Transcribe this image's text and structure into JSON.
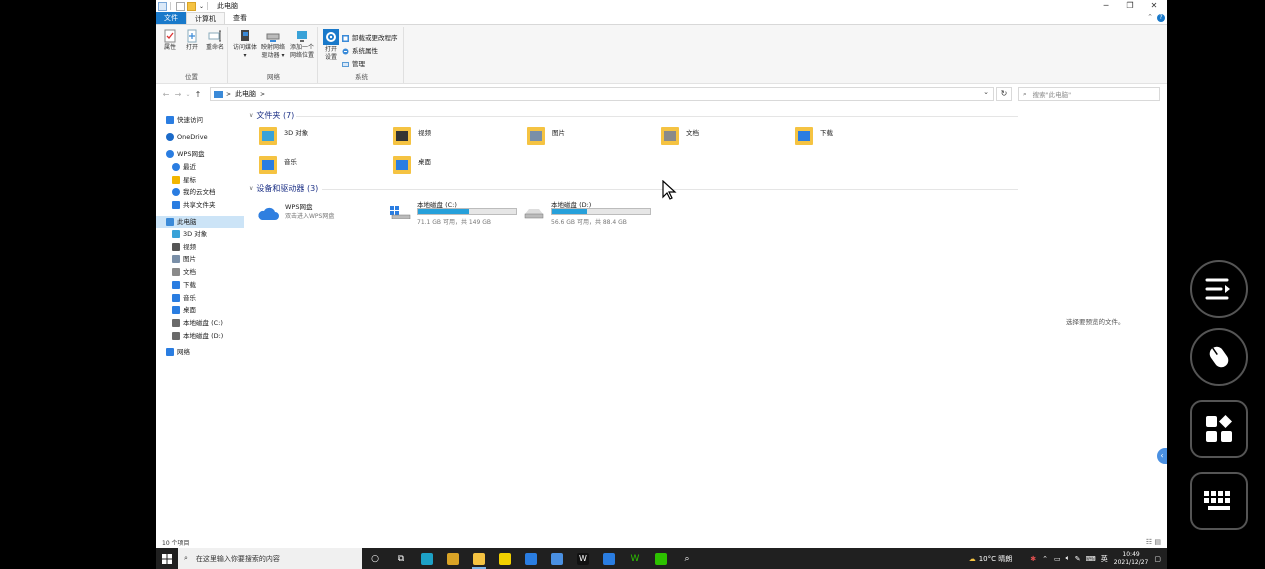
{
  "window": {
    "title": "此电脑",
    "minimize": "─",
    "restore": "❐",
    "close": "✕"
  },
  "ribbon": {
    "tabs": [
      "文件",
      "计算机",
      "查看"
    ],
    "groups": {
      "location": {
        "label": "位置",
        "buttons": [
          "属性",
          "打开",
          "重命名"
        ]
      },
      "network": {
        "label": "网络",
        "buttons": [
          {
            "line1": "访问媒体",
            "line2": "▾"
          },
          {
            "line1": "映射网络",
            "line2": "驱动器 ▾"
          },
          {
            "line1": "添加一个",
            "line2": "网络位置"
          }
        ]
      },
      "system": {
        "label": "系统",
        "open_settings_line1": "打开",
        "open_settings_line2": "设置",
        "small_buttons": [
          "卸载或更改程序",
          "系统属性",
          "管理"
        ]
      }
    }
  },
  "address": {
    "nav_back": "←",
    "nav_forward": "→",
    "nav_recent": "⌄",
    "nav_up": "↑",
    "path": "此电脑",
    "path_sep": ">",
    "dropdown": "⌄",
    "refresh": "↻",
    "search_glyph": "⌕",
    "search_placeholder": "搜索\"此电脑\""
  },
  "navpane": {
    "items": [
      {
        "label": "快速访问",
        "icon": "star-icon",
        "color": "#2a7de1"
      },
      {
        "label": "OneDrive",
        "icon": "cloud-icon",
        "color": "#1b6ac9"
      },
      {
        "label": "WPS网盘",
        "icon": "cloud-icon",
        "color": "#2a7de1"
      },
      {
        "label": "最近",
        "icon": "clock-icon",
        "color": "#2a7de1"
      },
      {
        "label": "星标",
        "icon": "star-icon",
        "color": "#f2b600"
      },
      {
        "label": "我的云文档",
        "icon": "cloud-icon",
        "color": "#2a7de1"
      },
      {
        "label": "共享文件夹",
        "icon": "share-icon",
        "color": "#2a7de1"
      },
      {
        "label": "此电脑",
        "icon": "computer-icon",
        "color": "#3b8ad8"
      },
      {
        "label": "3D 对象",
        "icon": "cube-icon",
        "color": "#39a2d8"
      },
      {
        "label": "视频",
        "icon": "video-icon",
        "color": "#555555"
      },
      {
        "label": "图片",
        "icon": "picture-icon",
        "color": "#7a8fa8"
      },
      {
        "label": "文档",
        "icon": "document-icon",
        "color": "#8a8a8a"
      },
      {
        "label": "下载",
        "icon": "download-icon",
        "color": "#2a7de1"
      },
      {
        "label": "音乐",
        "icon": "music-icon",
        "color": "#2a7de1"
      },
      {
        "label": "桌面",
        "icon": "desktop-icon",
        "color": "#2a7de1"
      },
      {
        "label": "本地磁盘 (C:)",
        "icon": "drive-icon",
        "color": "#6a6a6a"
      },
      {
        "label": "本地磁盘 (D:)",
        "icon": "drive-icon",
        "color": "#6a6a6a"
      },
      {
        "label": "网络",
        "icon": "network-icon",
        "color": "#2a7de1"
      }
    ]
  },
  "content": {
    "folders_header": "文件夹 (7)",
    "folders": [
      {
        "label": "3D 对象",
        "icon": "cube-folder-icon"
      },
      {
        "label": "视频",
        "icon": "video-folder-icon"
      },
      {
        "label": "图片",
        "icon": "picture-folder-icon"
      },
      {
        "label": "文档",
        "icon": "document-folder-icon"
      },
      {
        "label": "下载",
        "icon": "download-folder-icon"
      },
      {
        "label": "音乐",
        "icon": "music-folder-icon"
      },
      {
        "label": "桌面",
        "icon": "desktop-folder-icon"
      }
    ],
    "devices_header": "设备和驱动器 (3)",
    "wps": {
      "name": "WPS网盘",
      "sub": "双击进入WPS网盘"
    },
    "drives": [
      {
        "name": "本地磁盘 (C:)",
        "info": "71.1 GB 可用，共 149 GB",
        "used_fraction": 0.52
      },
      {
        "name": "本地磁盘 (D:)",
        "info": "56.6 GB 可用，共 88.4 GB",
        "used_fraction": 0.36
      }
    ],
    "preview_message": "选择要预览的文件。",
    "status": "10 个项目",
    "view_icons": "☷ ▤",
    "side_tab": "‹"
  },
  "taskbar": {
    "search_placeholder": "在这里输入你要搜索的内容",
    "search_glyph": "⌕",
    "apps": [
      {
        "name": "cortana-icon",
        "glyph": "○",
        "color": ""
      },
      {
        "name": "task-view-icon",
        "glyph": "⧉",
        "color": ""
      },
      {
        "name": "edge-icon",
        "glyph": "",
        "color": "#1da1c6"
      },
      {
        "name": "store-icon",
        "glyph": "",
        "color": "#d9a326"
      },
      {
        "name": "file-explorer-icon",
        "glyph": "",
        "color": "#f5c342"
      },
      {
        "name": "sticky-notes-icon",
        "glyph": "",
        "color": "#f2d100"
      },
      {
        "name": "mail-icon",
        "glyph": "",
        "color": "#2a7de1"
      },
      {
        "name": "app-a-icon",
        "glyph": "",
        "color": "#4a90e2"
      },
      {
        "name": "wps-writer-icon",
        "glyph": "W",
        "color": "#111111"
      },
      {
        "name": "app-blue-icon",
        "glyph": "",
        "color": "#2a7de1"
      },
      {
        "name": "wps-icon",
        "glyph": "W",
        "color": ""
      },
      {
        "name": "wechat-icon",
        "glyph": "",
        "color": "#2dc100"
      },
      {
        "name": "search-app-icon",
        "glyph": "⌕",
        "color": ""
      }
    ],
    "weather": "10°C 晴朗",
    "ime": "英",
    "time": "10:49",
    "date": "2021/12/27"
  }
}
